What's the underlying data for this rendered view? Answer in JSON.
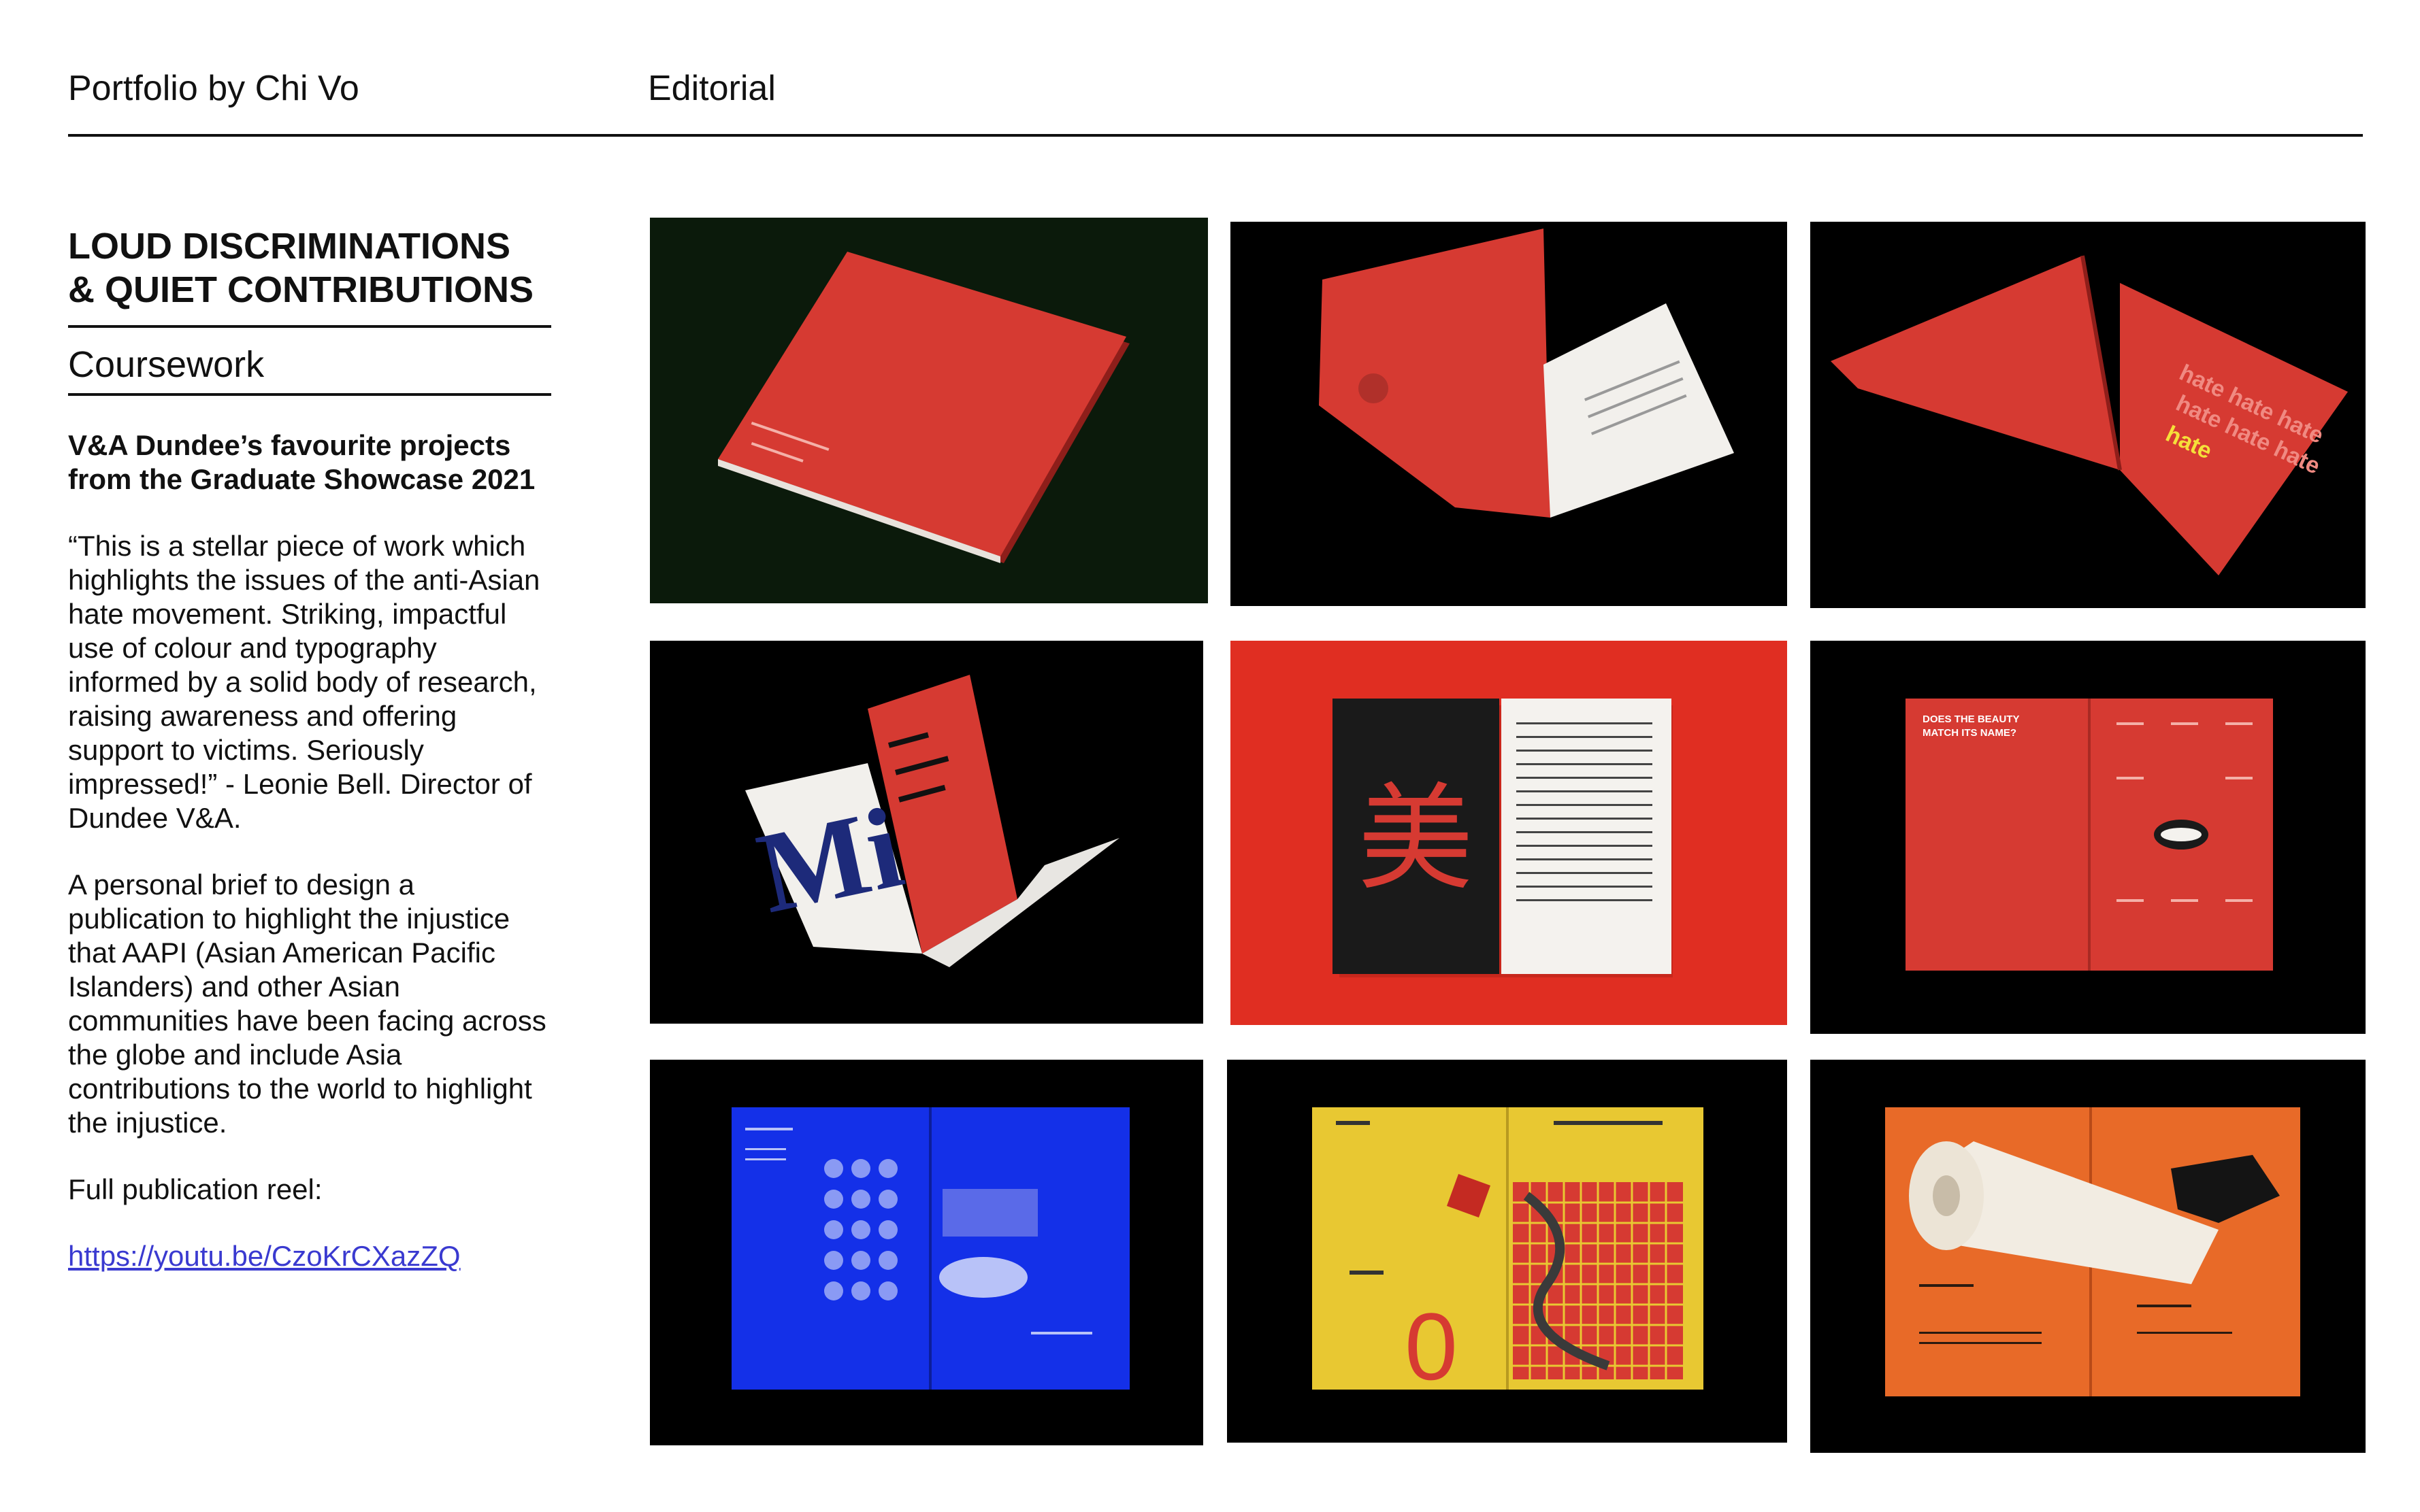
{
  "header": {
    "portfolio": "Portfolio by Chi Vo",
    "section": "Editorial"
  },
  "sidebar": {
    "title_line1": "LOUD DISCRIMINATIONS",
    "title_line2": "& QUIET CONTRIBUTIONS",
    "category": "Coursework",
    "award": "V&A Dundee’s favourite projects from the Graduate Showcase 2021",
    "quote": "“This is a stellar piece of work which highlights the issues of the anti-Asian hate movement. Striking, impactful use of colour and typography informed by a solid body of research, raising awareness and offering support to victims. Seriously impressed!” - Leonie Bell. Director of Dundee V&A.",
    "brief": "A personal brief to design a publication to highlight the injustice that AAPI (Asian American Pacific Islanders) and other Asian communities have been facing across the globe and include Asia contributions to the world to highlight the injustice.",
    "reel_label": "Full publication reel:",
    "reel_link": "https://youtu.be/CzoKrCXazZQ"
  },
  "gallery": {
    "images": [
      {
        "name": "cover-closed-red",
        "bg": "#0b1a0b"
      },
      {
        "name": "open-spread-portrait",
        "bg": "#000000"
      },
      {
        "name": "open-spread-hate",
        "bg": "#000000",
        "text": "hate"
      },
      {
        "name": "folded-mi-spread",
        "bg": "#000000",
        "text": "Mi"
      },
      {
        "name": "spread-mei-character",
        "bg": "#e02e22",
        "text": "美"
      },
      {
        "name": "spread-beauty-match",
        "bg": "#000000",
        "text": "DOES THE BEAUTY MATCH ITS NAME?"
      },
      {
        "name": "spread-playstation-blue",
        "bg": "#000000"
      },
      {
        "name": "spread-dice-snakes-ladders",
        "bg": "#000000",
        "text": "0"
      },
      {
        "name": "spread-toilet-paper-orange",
        "bg": "#000000"
      }
    ]
  },
  "colors": {
    "brand_red": "#d63a32",
    "blue": "#1430e8",
    "yellow": "#e8c832",
    "orange": "#e86a28",
    "link": "#3a3ad0"
  }
}
